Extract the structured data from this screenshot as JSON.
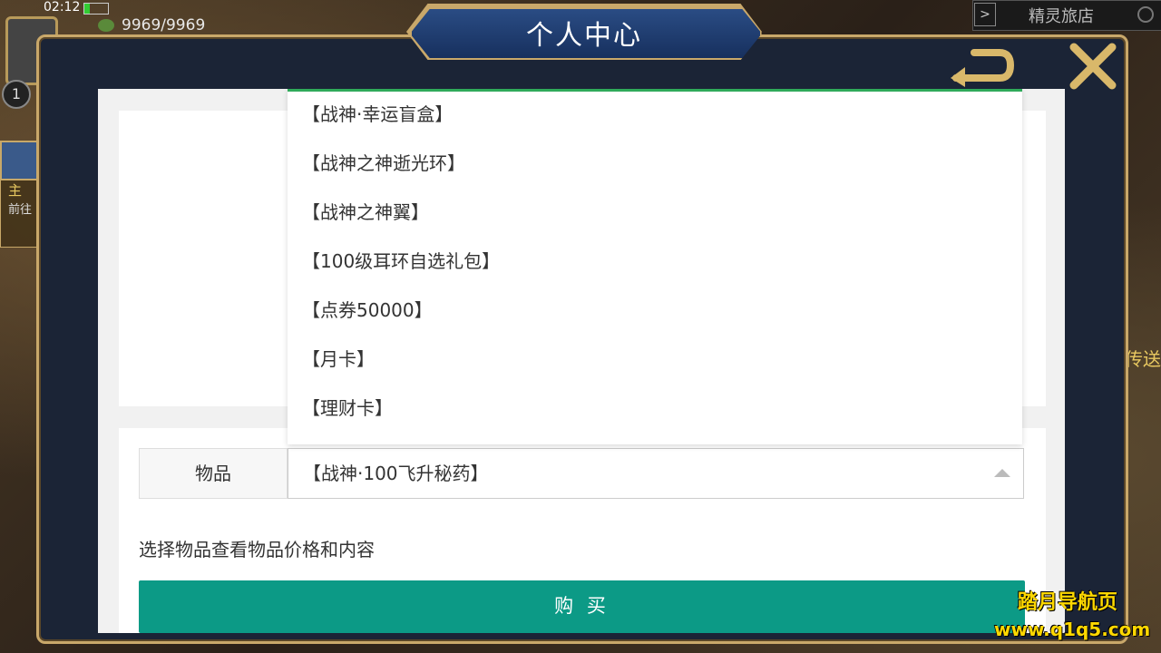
{
  "status": {
    "time": "02:12",
    "stamina": "9969/9969"
  },
  "hud": {
    "level": "1",
    "left_task_title": "主",
    "left_task_sub": "前往",
    "top_right_arrow": ">",
    "top_right_label": "精灵旅店",
    "right_edge_text": "传送"
  },
  "dialog": {
    "title": "个人中心"
  },
  "form": {
    "item_label": "物品",
    "selected_item": "【战神·100飞升秘药】",
    "hint": "选择物品查看物品价格和内容",
    "buy_label": "购 买"
  },
  "dropdown": {
    "options": [
      "【战神·幸运盲盒】",
      "【战神之神逝光环】",
      "【战神之神翼】",
      "【100级耳环自选礼包】",
      "【点券50000】",
      "【月卡】",
      "【理财卡】"
    ]
  },
  "watermark": {
    "line1": "踏月导航页",
    "line2": "www.q1q5.com"
  },
  "colors": {
    "accent": "#0c9a86",
    "frame_gold": "#c9a86a",
    "dialog_bg": "#1b2436",
    "dropdown_border": "#2faa5a"
  }
}
